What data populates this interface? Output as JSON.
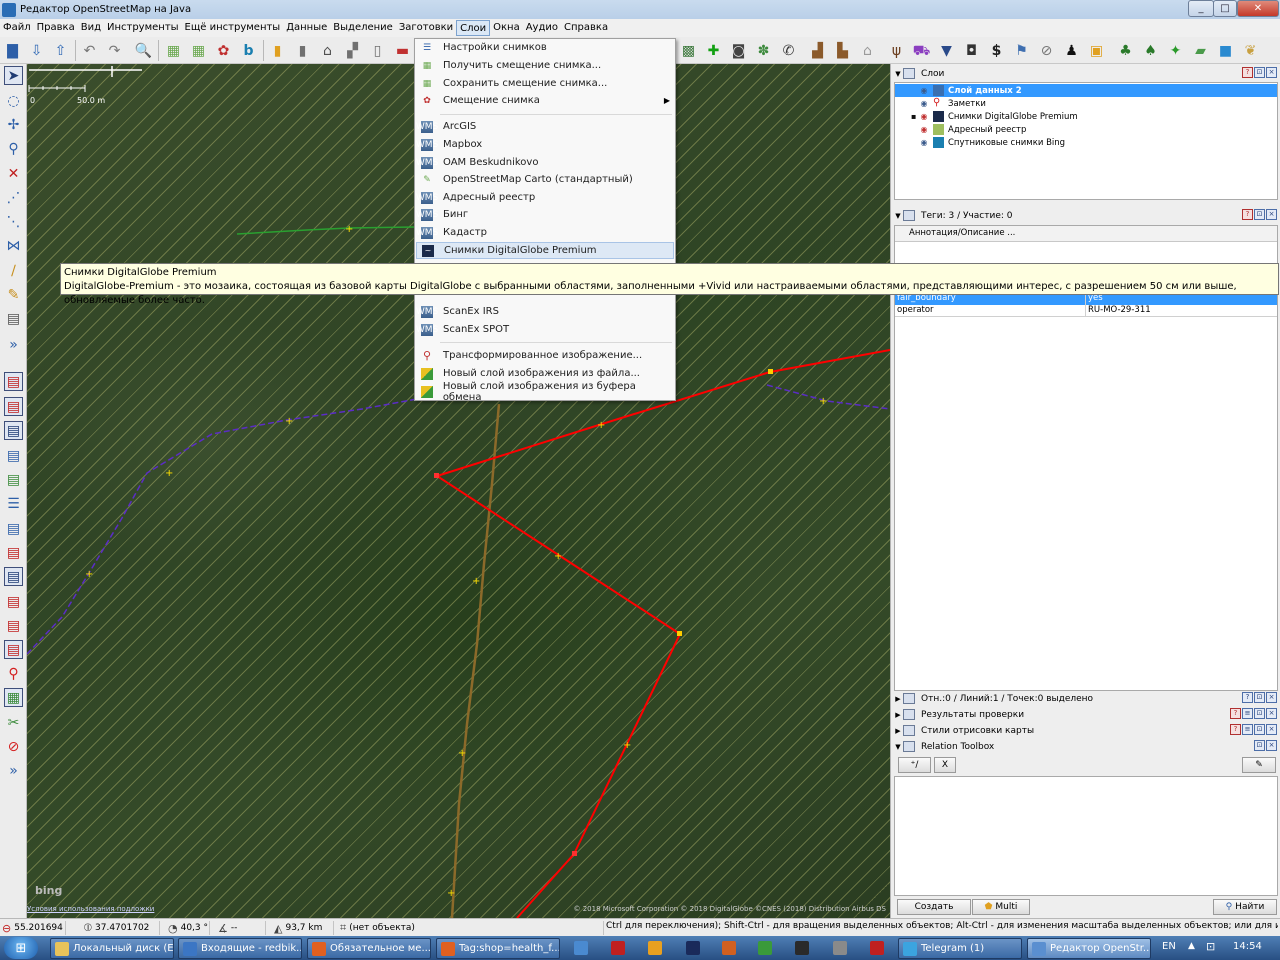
{
  "window": {
    "title": "Редактор OpenStreetMap на Java"
  },
  "menu": [
    "Файл",
    "Правка",
    "Вид",
    "Инструменты",
    "Ещё инструменты",
    "Данные",
    "Выделение",
    "Заготовки",
    "Слои",
    "Окна",
    "Аудио",
    "Справка"
  ],
  "active_menu": "Слои",
  "layers_menu": {
    "items": [
      {
        "label": "Настройки снимков",
        "icon": "preferences-icon"
      },
      {
        "label": "Получить смещение снимка...",
        "icon": "get-offset-icon"
      },
      {
        "label": "Сохранить смещение снимка...",
        "icon": "save-offset-icon"
      },
      {
        "label": "Смещение снимка",
        "icon": "offset-icon",
        "submenu": true
      },
      {
        "label": "ArcGIS",
        "icon": "wms-icon"
      },
      {
        "label": "Mapbox",
        "icon": "wms-icon"
      },
      {
        "label": "OAM Beskudnikovo",
        "icon": "wms-icon"
      },
      {
        "label": "OpenStreetMap Carto (стандартный)",
        "icon": "osm-icon"
      },
      {
        "label": "Адресный реестр",
        "icon": "wms-icon"
      },
      {
        "label": "Бинг",
        "icon": "wms-icon"
      },
      {
        "label": "Кадастр",
        "icon": "wms-icon"
      },
      {
        "label": "Снимки DigitalGlobe Premium",
        "icon": "digitalglobe-icon",
        "highlighted": true
      },
      {
        "label": "ScanEx IRS",
        "icon": "wms-icon"
      },
      {
        "label": "ScanEx SPOT",
        "icon": "wms-icon"
      },
      {
        "label": "Трансформированное изображение...",
        "icon": "pin-icon"
      },
      {
        "label": "Новый слой изображения из файла...",
        "icon": "image-file-icon"
      },
      {
        "label": "Новый слой изображения из буфера обмена",
        "icon": "image-clipboard-icon"
      }
    ]
  },
  "tooltip": {
    "title": "Снимки DigitalGlobe Premium",
    "description": "DigitalGlobe-Premium - это мозаика, состоящая из базовой карты DigitalGlobe с выбранными областями, заполненными +Vivid или настраиваемыми областями, представляющими интерес, с разрешением 50 см или выше, обновляемые более часто."
  },
  "map": {
    "scale_zero": "0",
    "scale_label": "50.0 m",
    "bing_logo": "bing",
    "terms_link": "Условия использования подложки",
    "attribution": "© 2018 Microsoft Corporation © 2018 DigitalGlobe ©CNES (2018) Distribution Airbus DS"
  },
  "layers_panel": {
    "title": "Слои",
    "layers": [
      {
        "name": "Слой данных 2",
        "selected": true,
        "icon_color": "#3a6fb0"
      },
      {
        "name": "Заметки",
        "selected": false,
        "icon_color": "#d42020"
      },
      {
        "name": "Снимки DigitalGlobe Premium",
        "selected": false,
        "icon_color": "#1b2a4a"
      },
      {
        "name": "Адресный реестр",
        "selected": false,
        "icon_color": "#9fbf5f"
      },
      {
        "name": "Спутниковые снимки Bing",
        "selected": false,
        "icon_color": "#1a7fb0"
      }
    ]
  },
  "tags_panel": {
    "title": "Теги: 3 / Участие: 0",
    "column": "Аннотация/Описание ...",
    "rows": [
      {
        "key": "fair_boundary",
        "value": "yes",
        "selected": true
      },
      {
        "key": "operator",
        "value": "RU-MO-29-311",
        "selected": false
      }
    ]
  },
  "collapsed_panels": [
    {
      "title": "Отн.:0 / Линий:1 / Точек:0 выделено"
    },
    {
      "title": "Результаты проверки"
    },
    {
      "title": "Стили отрисовки карты"
    }
  ],
  "relation_toolbox": {
    "title": "Relation Toolbox",
    "remove_label": "X"
  },
  "bottom_buttons": {
    "create": "Создать",
    "multi": "Multi",
    "find": "Найти"
  },
  "status": {
    "lat": "55.201694",
    "lon": "37.4701702",
    "heading": "40,3 °",
    "angle": "--",
    "distance": "93,7 km",
    "object": "(нет объекта)",
    "help": "Ctrl для переключения); Shift-Ctrl - для вращения выделенных объектов; Alt-Ctrl - для изменения масштаба выделенных объектов; или для изменения выделения"
  },
  "taskbar": {
    "tasks": [
      {
        "label": "Локальный диск (E:)",
        "color": "#e8c35a"
      },
      {
        "label": "Входящие - redbik...",
        "color": "#3b76c4"
      },
      {
        "label": "Обязательное ме...",
        "color": "#e06020"
      },
      {
        "label": "Tag:shop=health_f...",
        "color": "#e06020"
      },
      {
        "label": "Telegram (1)",
        "color": "#3ba4e0"
      },
      {
        "label": "Редактор OpenStr...",
        "color": "#5a8fd0",
        "active": true
      }
    ],
    "lang": "EN",
    "clock": "14:54"
  },
  "colors": {
    "selection": "#3399ff",
    "way_red": "#ff0000",
    "way_purple": "#5b2cc7",
    "menu_highlight": "#dde8f5",
    "tooltip_bg": "#ffffe1"
  }
}
